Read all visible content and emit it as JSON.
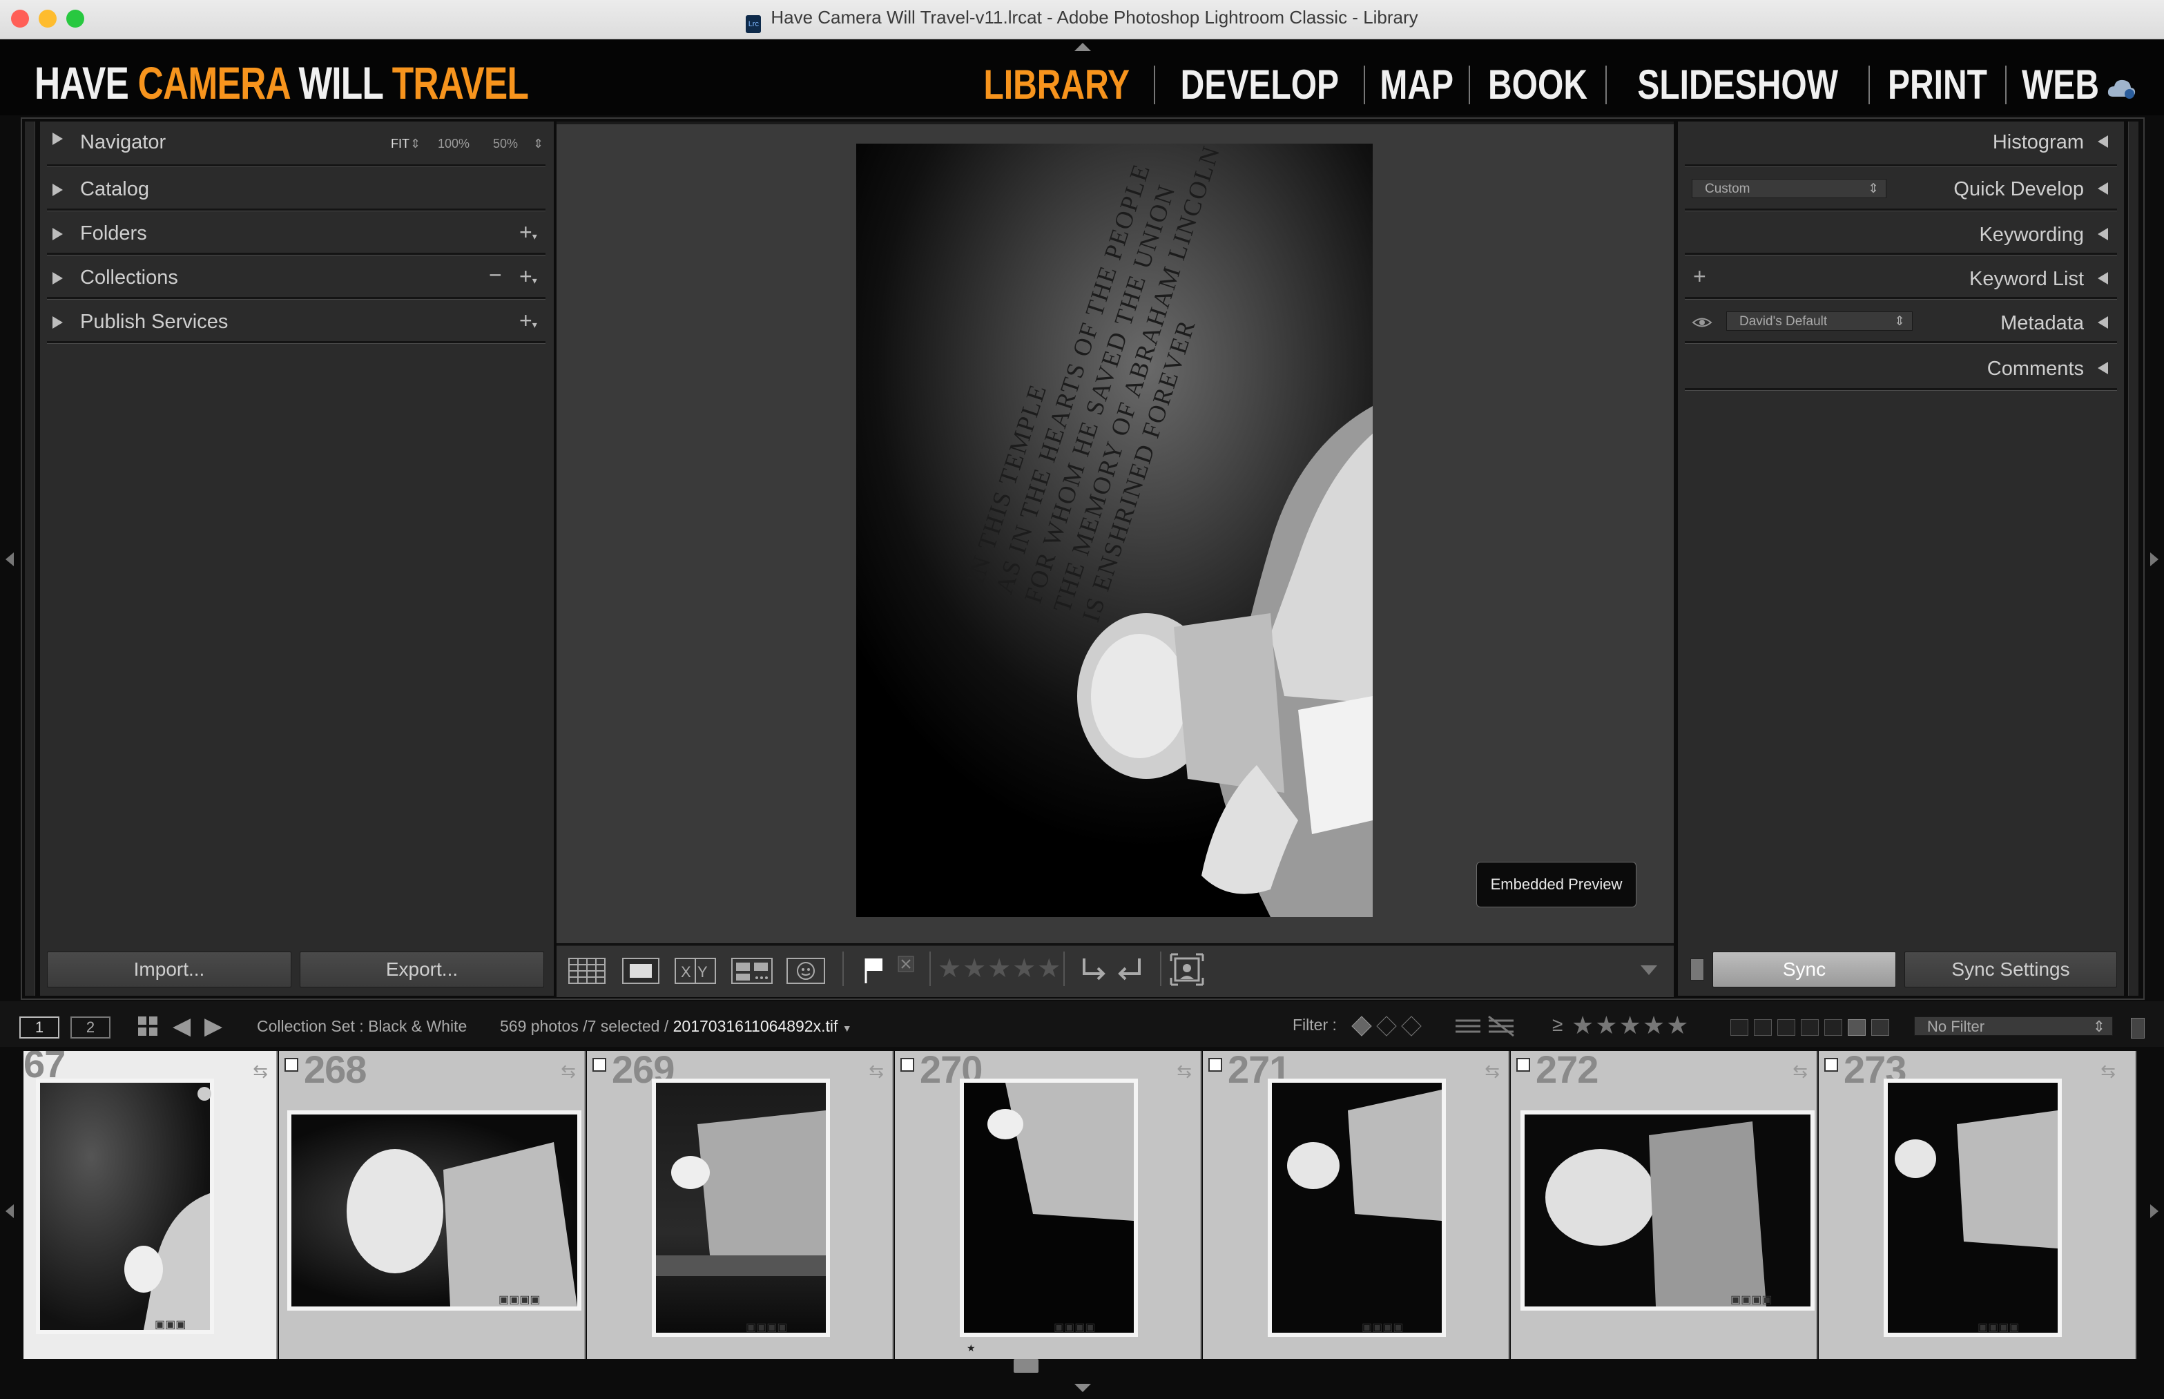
{
  "window": {
    "title": "Have Camera Will Travel-v11.lrcat - Adobe Photoshop Lightroom Classic - Library",
    "app_icon": "Lrc"
  },
  "identity_plate": {
    "part1": "HAVE ",
    "part2": "CAMERA",
    "part3": " WILL ",
    "part4": "TRAVEL"
  },
  "colors": {
    "accent": "#f7941d",
    "text": "#f0f0f0",
    "panel": "#2b2b2b"
  },
  "modules": [
    "LIBRARY",
    "DEVELOP",
    "MAP",
    "BOOK",
    "SLIDESHOW",
    "PRINT",
    "WEB"
  ],
  "active_module": "LIBRARY",
  "left_panel": {
    "navigator": {
      "label": "Navigator",
      "zoom_fit": "FIT",
      "zoom_100": "100%",
      "zoom_50": "50%"
    },
    "sections": [
      "Catalog",
      "Folders",
      "Collections",
      "Publish Services"
    ],
    "import_label": "Import...",
    "export_label": "Export..."
  },
  "right_panel": {
    "histogram": "Histogram",
    "quick_develop": "Quick Develop",
    "quick_develop_preset": "Custom",
    "keywording": "Keywording",
    "keyword_list": "Keyword List",
    "metadata": "Metadata",
    "metadata_preset": "David's Default",
    "comments": "Comments",
    "sync_label": "Sync",
    "sync_settings_label": "Sync Settings"
  },
  "main_image": {
    "inscription_lines": [
      "IN THIS TEMPLE",
      "AS IN THE HEARTS OF THE PEOPLE",
      "FOR WHOM HE SAVED THE UNION",
      "THE MEMORY OF ABRAHAM LINCOLN",
      "IS ENSHRINED FOREVER"
    ],
    "overlay_label": "Embedded Preview"
  },
  "filmstrip_bar": {
    "screen1": "1",
    "screen2": "2",
    "source": "Collection Set : Black & White",
    "count": "569 photos /7 selected /",
    "filename": "20170316110648​92x.tif",
    "filter_label": "Filter :",
    "filter_value": "No Filter",
    "rating_op": "≥"
  },
  "filmstrip": {
    "cells": [
      {
        "number": "67"
      },
      {
        "number": "268"
      },
      {
        "number": "269"
      },
      {
        "number": "270"
      },
      {
        "number": "271"
      },
      {
        "number": "272"
      },
      {
        "number": "273"
      }
    ]
  }
}
